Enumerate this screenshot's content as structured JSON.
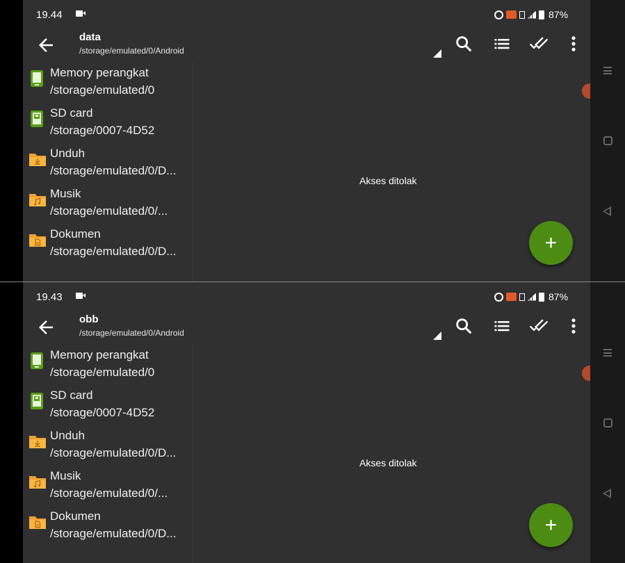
{
  "colors": {
    "screen_bg": "#303030",
    "fab": "#4c8c13",
    "folder": "#f0a030",
    "storage": "#5a9e1a",
    "cast": "#e05a2a"
  },
  "panels": [
    {
      "status": {
        "time": "19.44",
        "battery": "87%"
      },
      "toolbar": {
        "title": "data",
        "subtitle": "/storage/emulated/0/Android"
      },
      "sidebar": [
        {
          "label": "Memory perangkat",
          "path": "/storage/emulated/0",
          "icon": "phone-storage-icon"
        },
        {
          "label": "SD card",
          "path": "/storage/0007-4D52",
          "icon": "sd-card-icon"
        },
        {
          "label": "Unduh",
          "path": "/storage/emulated/0/D...",
          "icon": "download-folder-icon"
        },
        {
          "label": "Musik",
          "path": "/storage/emulated/0/...",
          "icon": "music-folder-icon"
        },
        {
          "label": "Dokumen",
          "path": "/storage/emulated/0/D...",
          "icon": "document-folder-icon"
        }
      ],
      "message": "Akses ditolak",
      "fab_label": "+"
    },
    {
      "status": {
        "time": "19.43",
        "battery": "87%"
      },
      "toolbar": {
        "title": "obb",
        "subtitle": "/storage/emulated/0/Android"
      },
      "sidebar": [
        {
          "label": "Memory perangkat",
          "path": "/storage/emulated/0",
          "icon": "phone-storage-icon"
        },
        {
          "label": "SD card",
          "path": "/storage/0007-4D52",
          "icon": "sd-card-icon"
        },
        {
          "label": "Unduh",
          "path": "/storage/emulated/0/D...",
          "icon": "download-folder-icon"
        },
        {
          "label": "Musik",
          "path": "/storage/emulated/0/...",
          "icon": "music-folder-icon"
        },
        {
          "label": "Dokumen",
          "path": "/storage/emulated/0/D...",
          "icon": "document-folder-icon"
        }
      ],
      "message": "Akses ditolak",
      "fab_label": "+"
    }
  ]
}
